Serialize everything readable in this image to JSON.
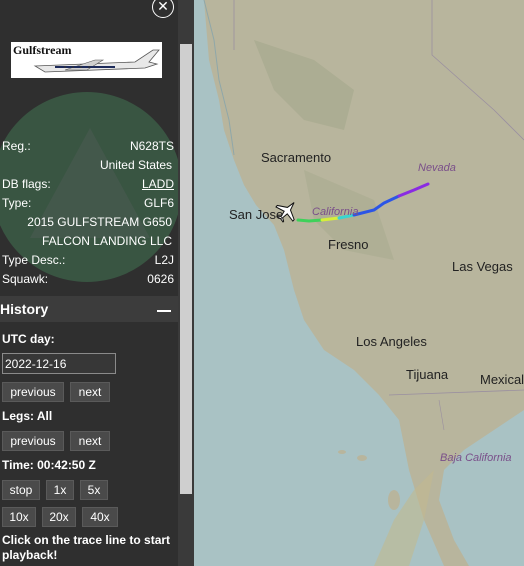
{
  "aircraft": {
    "logo_text": "Gulfstream",
    "reg_label": "Reg.:",
    "reg_value": "N628TS",
    "country": "United States",
    "dbflags_label": "DB flags:",
    "dbflags_value": "LADD",
    "type_label": "Type:",
    "type_value": "GLF6",
    "model": "2015 GULFSTREAM G650",
    "owner": "FALCON LANDING LLC",
    "typedesc_label": "Type Desc.:",
    "typedesc_value": "L2J",
    "squawk_label": "Squawk:",
    "squawk_value": "0626"
  },
  "history": {
    "title": "History",
    "utc_day_label": "UTC day:",
    "utc_day_value": "2022-12-16",
    "day_prev": "previous",
    "day_next": "next",
    "legs_label": "Legs: All",
    "legs_prev": "previous",
    "legs_next": "next",
    "time_label": "Time: 00:42:50 Z",
    "speeds": [
      "stop",
      "1x",
      "5x",
      "10x",
      "20x",
      "40x"
    ],
    "note": "Click on the trace line to start playback!"
  },
  "icons": {
    "close": "close-circle-icon",
    "minimize": "minus-icon",
    "aircraft": "airplane-icon"
  },
  "map": {
    "cities": [
      "Sacramento",
      "San Jose",
      "Fresno",
      "Las Vegas",
      "Los Angeles",
      "Tijuana",
      "Mexicali"
    ],
    "states": [
      "Nevada",
      "California",
      "Baja California"
    ],
    "colors": {
      "ocean": "#a9c2c4",
      "land": "#b7b39c",
      "sidebar": "#2f2f2f"
    }
  }
}
